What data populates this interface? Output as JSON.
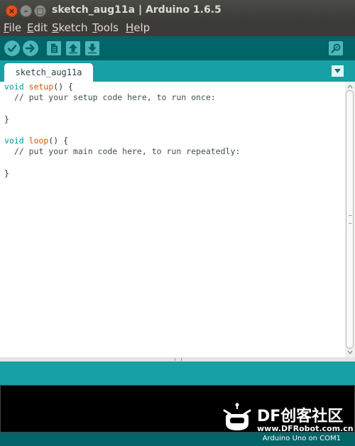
{
  "window": {
    "title": "sketch_aug11a | Arduino 1.6.5"
  },
  "menu": [
    {
      "mnemonic": "F",
      "rest": "ile"
    },
    {
      "mnemonic": "E",
      "rest": "dit"
    },
    {
      "mnemonic": "S",
      "rest": "ketch"
    },
    {
      "mnemonic": "T",
      "rest": "ools"
    },
    {
      "mnemonic": "H",
      "rest": "elp"
    }
  ],
  "toolbar": {
    "icons": [
      "verify-icon",
      "upload-icon",
      "new-icon",
      "open-icon",
      "save-icon",
      "serial-monitor-icon"
    ],
    "accent": "#4db7bb",
    "background": "#006468"
  },
  "tabs": [
    {
      "label": "sketch_aug11a"
    }
  ],
  "editor": {
    "lines": [
      {
        "parts": [
          {
            "t": "void",
            "c": "kw"
          },
          {
            "t": " "
          },
          {
            "t": "setup",
            "c": "fn"
          },
          {
            "t": "() {"
          }
        ]
      },
      {
        "parts": [
          {
            "t": "  // put your setup code here, to run once:",
            "c": "cm"
          }
        ]
      },
      {
        "parts": [
          {
            "t": ""
          }
        ]
      },
      {
        "parts": [
          {
            "t": "}"
          }
        ]
      },
      {
        "parts": [
          {
            "t": ""
          }
        ]
      },
      {
        "parts": [
          {
            "t": "void",
            "c": "kw"
          },
          {
            "t": " "
          },
          {
            "t": "loop",
            "c": "fn"
          },
          {
            "t": "() {"
          }
        ]
      },
      {
        "parts": [
          {
            "t": "  // put your main code here, to run repeatedly:",
            "c": "cm"
          }
        ]
      },
      {
        "parts": [
          {
            "t": ""
          }
        ]
      },
      {
        "parts": [
          {
            "t": "}"
          }
        ]
      }
    ]
  },
  "status": {
    "board": "Arduino Uno on COM1"
  },
  "watermark": {
    "brand": "DF创客社区",
    "url": "www.DFRobot.com.cn"
  }
}
